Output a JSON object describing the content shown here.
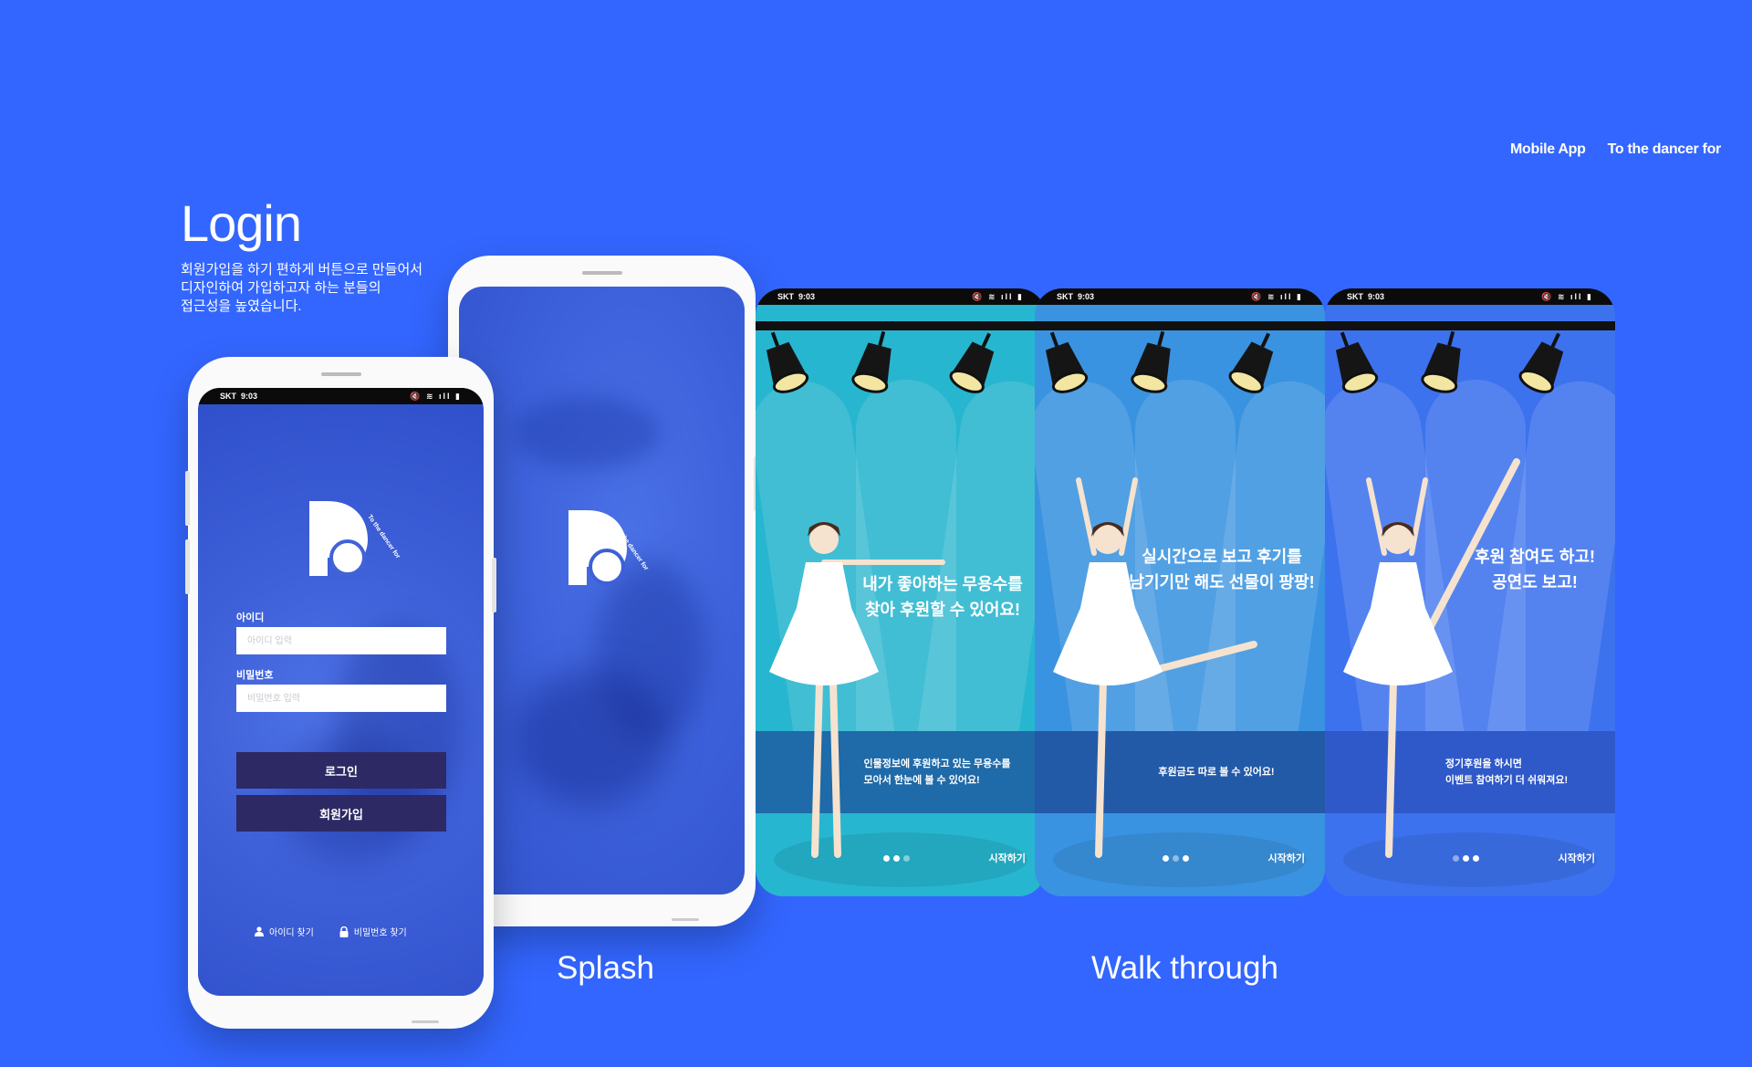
{
  "nav": {
    "item1": "Mobile App",
    "item2": "To the dancer for"
  },
  "intro": {
    "title": "Login",
    "desc_line1": "회원가입을 하기 편하게 버튼으로 만들어서",
    "desc_line2": "디자인하여 가입하고자 하는 분들의",
    "desc_line3": "접근성을 높였습니다."
  },
  "labels": {
    "splash": "Splash",
    "walkthrough": "Walk through"
  },
  "status": {
    "carrier": "SKT",
    "time": "9:03",
    "icons": "🔇 ≋ ıll ▮"
  },
  "login": {
    "id_label": "아이디",
    "id_placeholder": "아이디 입력",
    "pw_label": "비밀번호",
    "pw_placeholder": "비밀번호 입력",
    "login_button": "로그인",
    "signup_button": "회원가입",
    "find_id": "아이디 찾기",
    "find_pw": "비밀번호 찾기"
  },
  "brand": {
    "logo_letter": "D",
    "logo_text": "To the dancer for"
  },
  "walkthrough": [
    {
      "headline1": "내가 좋아하는 무용수를",
      "headline2": "찾아 후원할 수 있어요!",
      "band1": "인물정보에 후원하고 있는 무용수를",
      "band2": "모아서 한눈에 볼 수 있어요!",
      "start": "시작하기",
      "active_dot": 2,
      "bg": "#27b6cf",
      "band_color": "#1f6aa8"
    },
    {
      "headline1": "실시간으로 보고 후기를",
      "headline2": "남기기만 해도 선물이 팡팡!",
      "band1": "후원금도 따로 볼 수 있어요!",
      "band2": "",
      "start": "시작하기",
      "active_dot": 1,
      "bg": "#3a93e0",
      "band_color": "#225aa8"
    },
    {
      "headline1": "후원 참여도 하고!",
      "headline2": "공연도 보고!",
      "band1": "정기후원을 하시면",
      "band2": "이벤트 참여하기 더 쉬워져요!",
      "start": "시작하기",
      "active_dot": 0,
      "bg": "#3d72ee",
      "band_color": "#2f58c8"
    }
  ],
  "colors": {
    "page_bg": "#3366ff",
    "button_dark": "#2d2965"
  }
}
